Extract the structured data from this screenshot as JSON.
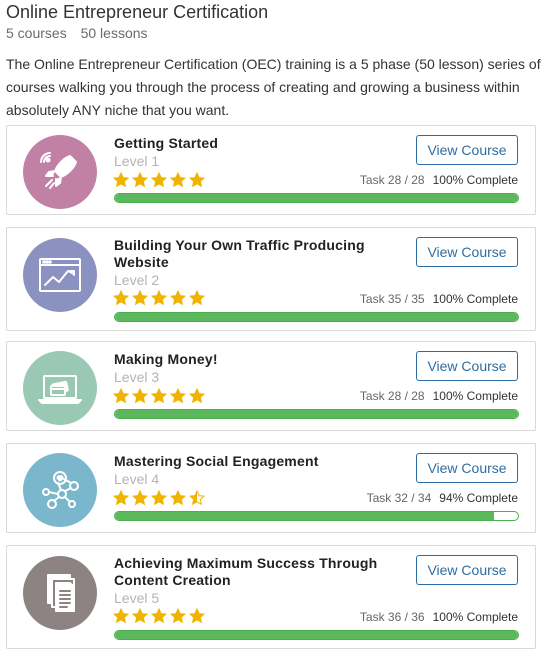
{
  "header": {
    "title": "Online Entrepreneur Certification",
    "courses_count": "5 courses",
    "lessons_count": "50 lessons",
    "description": "The Online Entrepreneur Certification (OEC) training is a 5 phase (50 lesson) series of courses walking you through the process of creating and growing a business within absolutely ANY niche that you want."
  },
  "colors": {
    "accent": "#2e6da4",
    "progress": "#5cb85c",
    "star": "#f0b400"
  },
  "courses": [
    {
      "title": "Getting Started",
      "level": "Level 1",
      "rating": 5,
      "task": "Task 28 / 28",
      "complete": "100% Complete",
      "progress": 1.0,
      "button": "View Course",
      "icon": "rocket-icon",
      "icon_color": "#c081a5"
    },
    {
      "title": "Building Your Own Traffic Producing Website",
      "level": "Level 2",
      "rating": 5,
      "task": "Task 35 / 35",
      "complete": "100% Complete",
      "progress": 1.0,
      "button": "View Course",
      "icon": "website-chart-icon",
      "icon_color": "#8b91c0"
    },
    {
      "title": "Making Money!",
      "level": "Level 3",
      "rating": 5,
      "task": "Task 28 / 28",
      "complete": "100% Complete",
      "progress": 1.0,
      "button": "View Course",
      "icon": "laptop-card-icon",
      "icon_color": "#99c9b5"
    },
    {
      "title": "Mastering Social Engagement",
      "level": "Level 4",
      "rating": 4.5,
      "task": "Task 32 / 34",
      "complete": "94% Complete",
      "progress": 0.94,
      "button": "View Course",
      "icon": "social-network-icon",
      "icon_color": "#7ab6cc"
    },
    {
      "title": "Achieving Maximum Success Through Content Creation",
      "level": "Level 5",
      "rating": 5,
      "task": "Task 36 / 36",
      "complete": "100% Complete",
      "progress": 1.0,
      "button": "View Course",
      "icon": "documents-icon",
      "icon_color": "#8d8383"
    }
  ]
}
